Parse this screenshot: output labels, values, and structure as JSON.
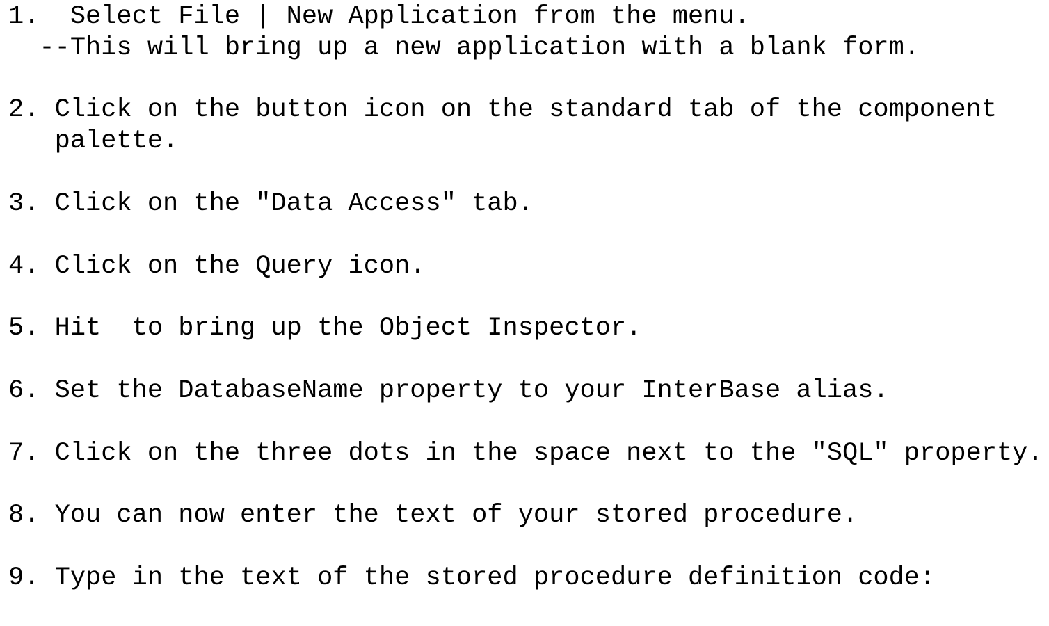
{
  "steps": [
    {
      "line1": "1.  Select File | New Application from the menu.",
      "line2": "  --This will bring up a new application with a blank form."
    },
    {
      "line1": "2. Click on the button icon on the standard tab of the component",
      "line2": "   palette."
    },
    {
      "line1": "3. Click on the \"Data Access\" tab."
    },
    {
      "line1": "4. Click on the Query icon."
    },
    {
      "line1": "5. Hit  to bring up the Object Inspector."
    },
    {
      "line1": "6. Set the DatabaseName property to your InterBase alias."
    },
    {
      "line1": "7. Click on the three dots in the space next to the \"SQL\" property."
    },
    {
      "line1": "8. You can now enter the text of your stored procedure."
    },
    {
      "line1": "9. Type in the text of the stored procedure definition code:"
    }
  ]
}
